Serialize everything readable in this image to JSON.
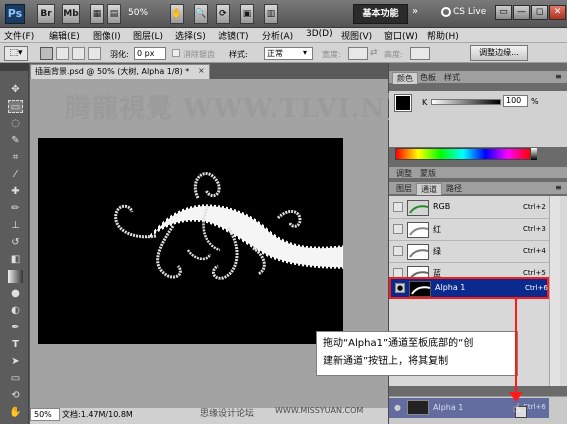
{
  "appbar": {
    "ps_logo": "Ps",
    "br_label": "Br",
    "mb_label": "Mb",
    "zoom": "50%",
    "workspace_button": "基本功能",
    "cs_live": "CS Live",
    "window_buttons": [
      "▭",
      "—",
      "◻",
      "✕"
    ]
  },
  "menubar": {
    "items": [
      "文件(F)",
      "编辑(E)",
      "图像(I)",
      "图层(L)",
      "选择(S)",
      "滤镜(T)",
      "分析(A)",
      "3D(D)",
      "视图(V)",
      "窗口(W)",
      "帮助(H)"
    ]
  },
  "options": {
    "feather_label": "羽化:",
    "feather_value": "0 px",
    "antialias_label": "消除锯齿",
    "style_label": "样式:",
    "style_value": "正常",
    "width_label": "宽度:",
    "height_label": "高度:",
    "refine_edge_button": "调整边缘..."
  },
  "document": {
    "tab_title": "插画背景.psd @ 50% (大树, Alpha 1/8) *",
    "tab_close": "×",
    "status_zoom": "50%",
    "status_doc": "文档:1.47M/10.8M"
  },
  "watermarks": {
    "top": "腾龍視覺 WWW.TLVI.NET",
    "bottom_cn": "思缘设计论坛",
    "bottom_en": "WWW.MISSYUAN.COM"
  },
  "color_panel": {
    "tabs": [
      "颜色",
      "色板",
      "样式"
    ],
    "channel_label": "K",
    "value": "100",
    "unit": "%"
  },
  "adjust_panel": {
    "tabs": [
      "调整",
      "蒙版"
    ]
  },
  "layers_panel": {
    "tabs": [
      "图层",
      "通道",
      "路径"
    ],
    "channels": [
      {
        "name": "RGB",
        "shortcut": "Ctrl+2",
        "visible": false
      },
      {
        "name": "红",
        "shortcut": "Ctrl+3",
        "visible": false
      },
      {
        "name": "绿",
        "shortcut": "Ctrl+4",
        "visible": false
      },
      {
        "name": "蓝",
        "shortcut": "Ctrl+5",
        "visible": false
      },
      {
        "name": "Alpha 1",
        "shortcut": "Ctrl+6",
        "visible": true,
        "selected": true
      }
    ],
    "drag_ghost_label": "Alpha 1",
    "drag_ghost_shortcut": "Ctrl+6"
  },
  "callout": {
    "line1": "拖动“Alpha1”通道至板底部的“创",
    "line2": "建新通道”按钮上，将其复制"
  },
  "colors": {
    "accent_red": "#ff1a1a",
    "selected_row": "#0a2a8e"
  }
}
